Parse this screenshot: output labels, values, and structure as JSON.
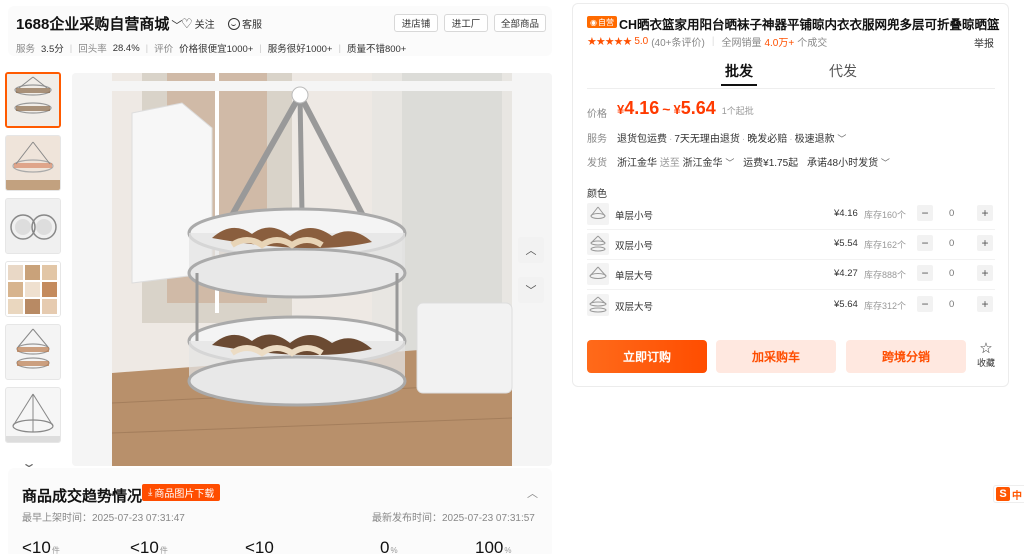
{
  "store": {
    "name": "1688企业采购自营商城",
    "follow_label": "关注",
    "service_label": "客服",
    "buttons": [
      "进店铺",
      "进工厂",
      "全部商品"
    ],
    "stats": {
      "service_label": "服务",
      "service_value": "3.5分",
      "repurchase_label": "回头率",
      "repurchase_value": "28.4%",
      "eval_label": "评价",
      "tags": [
        "价格很便宜1000+",
        "服务很好1000+",
        "质量不错800+"
      ]
    }
  },
  "gallery": {
    "thumb_count": 6,
    "up_icon": "chevron-up-icon",
    "down_icon": "chevron-down-icon"
  },
  "trend": {
    "title": "商品成交趋势情况",
    "download_label": "商品图片下载",
    "earliest_label": "最早上架时间：",
    "earliest_value": "2025-07-23 07:31:47",
    "latest_label": "最新发布时间：",
    "latest_value": "2025-07-23 07:31:57",
    "numbers": [
      {
        "value": "<10",
        "unit": "件"
      },
      {
        "value": "<10",
        "unit": "件"
      },
      {
        "value": "<10",
        "unit": ""
      },
      {
        "value": "0",
        "unit": "%"
      },
      {
        "value": "100",
        "unit": "%"
      }
    ]
  },
  "product": {
    "badge": "自营",
    "title": "CH晒衣篮家用阳台晒袜子神器平铺晾内衣衣服网兜多层可折叠晾晒篮",
    "stars": "★★★★★",
    "score": "5.0",
    "reviews": "(40+条评价)",
    "sales_label": "全网销量",
    "sales_value": "4.0万+",
    "sales_unit": "个成交",
    "report_label": "举报",
    "tabs": [
      "批发",
      "代发"
    ],
    "price_label": "价格",
    "price_low": "4.16",
    "price_high": "5.64",
    "min_order": "1个起批",
    "service_label": "服务",
    "services": [
      "退货包运费",
      "7天无理由退货",
      "晚发必赔",
      "极速退款"
    ],
    "ship_label": "发货",
    "ship_from": "浙江金华",
    "ship_to_label": "送至",
    "ship_to": "浙江金华",
    "freight": "运费¥1.75起",
    "promise": "承诺48小时发货",
    "color_label": "颜色",
    "skus": [
      {
        "name": "单层小号",
        "price": "¥4.16",
        "stock": "库存160个",
        "qty": "0"
      },
      {
        "name": "双层小号",
        "price": "¥5.54",
        "stock": "库存162个",
        "qty": "0"
      },
      {
        "name": "单层大号",
        "price": "¥4.27",
        "stock": "库存888个",
        "qty": "0"
      },
      {
        "name": "双层大号",
        "price": "¥5.64",
        "stock": "库存312个",
        "qty": "0"
      }
    ],
    "buttons": {
      "order": "立即订购",
      "cart": "加采购车",
      "dist": "跨境分销"
    },
    "fav_label": "收藏"
  },
  "ime": {
    "letter": "S",
    "text": "中"
  },
  "colors": {
    "accent": "#ff4d00",
    "accent_light": "#ffe8e0",
    "badge": "#ff6a00"
  }
}
